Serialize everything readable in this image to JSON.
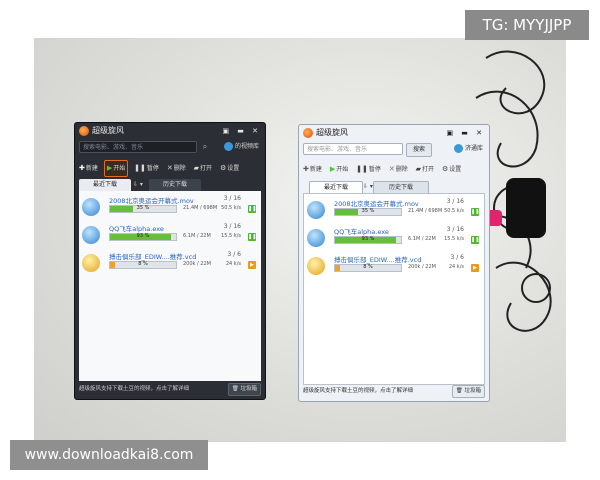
{
  "watermarks": {
    "tg": "TG: MYYJJPP",
    "site": "www.downloadkai8.com"
  },
  "app": {
    "title": "超级旋风",
    "window_controls": "▣ ▬ ✕",
    "search_placeholder": "搜索电影、游戏、音乐",
    "search_button_light": "搜索",
    "video_library": "的视频库",
    "video_library_light": "济通库",
    "toolbar": {
      "new": "新建",
      "start": "开始",
      "pause": "暂停",
      "delete": "删除",
      "open": "打开",
      "settings": "设置"
    },
    "tabs": {
      "recent": "最近下载",
      "history": "历史下载"
    },
    "downloads": [
      {
        "name": "2008北京奥运会开幕式.mov",
        "count": "3 / 16",
        "progress_text": "35 %",
        "progress": 0.35,
        "size": "21.4M / 698M",
        "speed": "50.5 k/s",
        "icon": "video-file-icon",
        "state": "downloading"
      },
      {
        "name": "QQ飞车alpha.exe",
        "count": "3 / 16",
        "progress_text": "93 %",
        "progress": 0.93,
        "size": "6.1M / 22M",
        "speed": "15.5 k/s",
        "icon": "exe-file-icon",
        "state": "downloading"
      },
      {
        "name": "搏击俱乐部_EDIW....推荐.vcd",
        "count": "3 / 6",
        "progress_text": "8 %",
        "progress": 0.08,
        "size": "200k / 22M",
        "speed": "24 k/s",
        "icon": "video-file-icon",
        "state": "paused"
      }
    ],
    "status_text": "超级旋风支持下载土豆的视频，点击了解详细",
    "recycle_bin": "垃圾箱"
  },
  "colors": {
    "dark_window": "#2b2f35",
    "light_window": "#eef1f5",
    "progress_green": "#63bf3d",
    "progress_orange": "#f0a030",
    "link_blue": "#2a62c4"
  }
}
